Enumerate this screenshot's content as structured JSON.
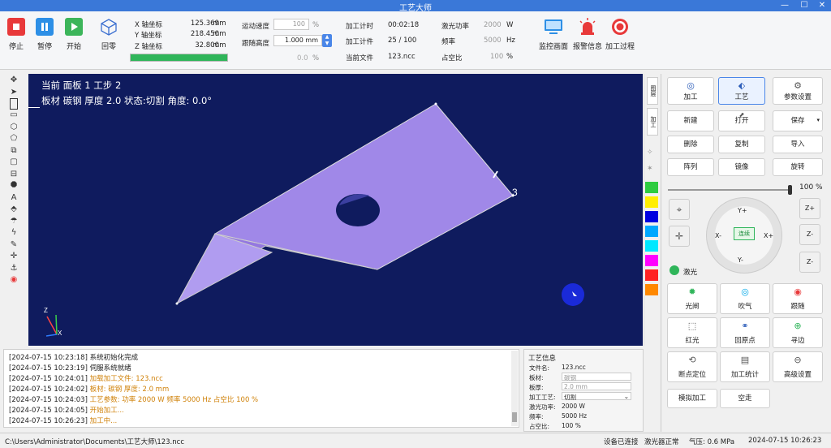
{
  "window": {
    "title": "工艺大师",
    "minimize": "—",
    "maximize": "☐",
    "close": "✕"
  },
  "toolbar": {
    "stop": "停止",
    "pause": "暂停",
    "start": "开始",
    "home": "回零",
    "monitor": "监控画面",
    "alarm": "报警信息",
    "process": "加工过程"
  },
  "coords": {
    "x_label": "X 轴坐标",
    "x_value": "125.369",
    "x_unit": "mm",
    "y_label": "Y 轴坐标",
    "y_value": "218.450",
    "y_unit": "mm",
    "z_label": "Z 轴坐标",
    "z_value": "32.800",
    "z_unit": "mm",
    "progress": 1.0
  },
  "motion": {
    "speed_label": "运动速度",
    "speed_value": "100",
    "speed_unit": "%",
    "follow_label": "跟随高度",
    "follow_value": "1.000",
    "follow_unit": "mm",
    "third_value": "0.0",
    "third_unit": "%"
  },
  "job": {
    "time_label": "加工计时",
    "time_value": "00:02:18",
    "count_label": "加工计件",
    "count_value": "25 / 100",
    "file_label": "当前文件",
    "file_value": "123.ncc",
    "power_label": "激光功率",
    "power_value": "2000",
    "power_unit": "W",
    "freq_label": "频率",
    "freq_value": "5000",
    "freq_unit": "Hz",
    "duty_label": "占空比",
    "duty_value": "100",
    "duty_unit": "%"
  },
  "viewport": {
    "line1": "当前  面板 1  工步 2",
    "line2": "板材  碳钢  厚度 2.0  状态:切割  角度: 0.0°",
    "label_3": "3",
    "axis_x": "X",
    "axis_y": "Y",
    "axis_z": "Z"
  },
  "side_tabs": {
    "tab1": "图层",
    "tab2": "加工",
    "tab3": "工艺"
  },
  "panel": {
    "tabs": [
      "加工",
      "工艺",
      "参数设置"
    ],
    "actions": [
      "新建",
      "打开",
      "保存",
      "删除",
      "复制",
      "导入",
      "阵列",
      "镜像",
      "旋转"
    ],
    "speed_percent": "100 %",
    "speed_value": 1.0,
    "jog": {
      "up": "Y+",
      "down": "Y-",
      "left": "X-",
      "right": "X+",
      "center": "连续"
    },
    "z_buttons": [
      "Z+",
      "Z-",
      "Z-"
    ],
    "laser_label": "激光",
    "funcs": [
      "光闸",
      "吹气",
      "跟随",
      "红光",
      "回原点",
      "寻边",
      "断点定位",
      "加工统计",
      "高级设置"
    ],
    "bottom": [
      "模拟加工",
      "空走"
    ]
  },
  "log": [
    {
      "time": "[2024-07-15 10:23:18]",
      "msg": "系统初始化完成",
      "color": "#222222"
    },
    {
      "time": "[2024-07-15 10:23:19]",
      "msg": "伺服系统就绪",
      "color": "#222222"
    },
    {
      "time": "[2024-07-15 10:24:01]",
      "msg": "加载加工文件: 123.ncc",
      "color": "#d0820a"
    },
    {
      "time": "[2024-07-15 10:24:02]",
      "msg": "板材: 碳钢  厚度: 2.0 mm",
      "color": "#d0820a"
    },
    {
      "time": "[2024-07-15 10:24:03]",
      "msg": "工艺参数: 功率 2000 W  频率 5000 Hz  占空比 100 %",
      "color": "#d0820a"
    },
    {
      "time": "[2024-07-15 10:24:05]",
      "msg": "开始加工...",
      "color": "#d0820a"
    },
    {
      "time": "[2024-07-15 10:26:23]",
      "msg": "加工中...",
      "color": "#d0820a"
    }
  ],
  "info": {
    "title": "工艺信息",
    "rows": [
      {
        "label": "文件名:",
        "value": "123.ncc"
      },
      {
        "label": "板材:",
        "value": "碳钢"
      },
      {
        "label": "板厚:",
        "value": "2.0 mm"
      },
      {
        "label": "加工工艺:",
        "value": "切割"
      },
      {
        "label": "激光功率:",
        "value": "2000  W"
      },
      {
        "label": "频率:",
        "value": "5000  Hz"
      },
      {
        "label": "占空比:",
        "value": "100   %"
      }
    ]
  },
  "status": {
    "path": "C:\\Users\\Administrator\\Documents\\工艺大师\\123.ncc",
    "device": "设备已连接",
    "laser": "激光器正常",
    "pressure": "气压: 0.6 MPa",
    "datetime": "2024-07-15  10:26:23"
  },
  "swatches": [
    "#2ecc40",
    "#ffee00",
    "#0000e0",
    "#00a8ff",
    "#00e8ff",
    "#ff00ff",
    "#ff2222",
    "#ff8800"
  ]
}
